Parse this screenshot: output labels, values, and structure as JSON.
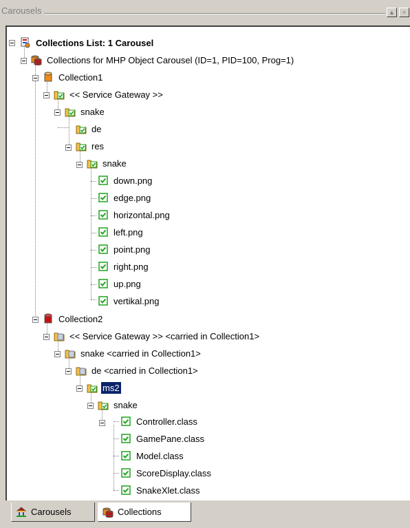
{
  "panel": {
    "title": "Carousels"
  },
  "tree": {
    "root": "Collections List: 1 Carousel",
    "carousel": "Collections for MHP Object Carousel (ID=1, PID=100, Prog=1)",
    "collection1": {
      "label": "Collection1",
      "gateway": "<< Service Gateway >>",
      "snake": "snake",
      "de": "de",
      "res": "res",
      "res_snake": "snake",
      "files": [
        "down.png",
        "edge.png",
        "horizontal.png",
        "left.png",
        "point.png",
        "right.png",
        "up.png",
        "vertikal.png"
      ]
    },
    "collection2": {
      "label": "Collection2",
      "gateway": "<< Service Gateway >> <carried in Collection1>",
      "snake": "snake <carried in Collection1>",
      "de": "de <carried in Collection1>",
      "ms2": "ms2",
      "ms2_snake": "snake",
      "files": [
        "Controller.class",
        "GamePane.class",
        "Model.class",
        "ScoreDisplay.class",
        "SnakeXlet.class"
      ]
    }
  },
  "tabs": [
    {
      "label": "Carousels",
      "active": true
    },
    {
      "label": "Collections",
      "active": false
    }
  ],
  "colors": {
    "selection": "#0a246a",
    "folder_orange": "#f4c04a",
    "folder_gray": "#c8d0dc",
    "check_green": "#1fa31f",
    "db_red": "#c81010",
    "db_orange": "#f08a18"
  }
}
